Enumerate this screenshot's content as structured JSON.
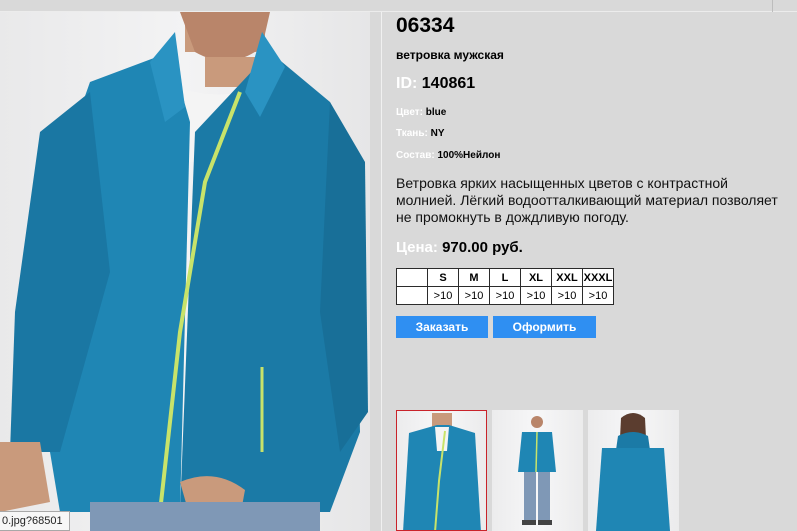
{
  "product": {
    "code": "06334",
    "subtitle": "ветровка мужская",
    "id_label": "ID:",
    "id_value": "140861",
    "attributes": [
      {
        "label": "Цвет:",
        "value": "blue"
      },
      {
        "label": "Ткань:",
        "value": "NY"
      },
      {
        "label": "Состав:",
        "value": "100%Нейлон"
      }
    ],
    "description": "Ветровка ярких насыщенных цветов с контрастной молнией. Лёгкий водоотталкивающий материал позволяет не промокнуть в дождливую погоду.",
    "price_label": "Цена:",
    "price_value": "970.00 руб."
  },
  "sizes": {
    "headers": [
      "",
      "S",
      "M",
      "L",
      "XL",
      "XXL",
      "XXXL"
    ],
    "values": [
      "",
      ">10",
      ">10",
      ">10",
      ">10",
      ">10",
      ">10"
    ]
  },
  "buttons": {
    "order": "Заказать",
    "checkout": "Оформить"
  },
  "status_url": "0.jpg?68501",
  "colors": {
    "jacket": "#1f86b4",
    "zipper": "#c8e36a",
    "button": "#2f8ff2",
    "selected_thumb_border": "#c9232a",
    "panel_bg": "#d9d9d9"
  }
}
